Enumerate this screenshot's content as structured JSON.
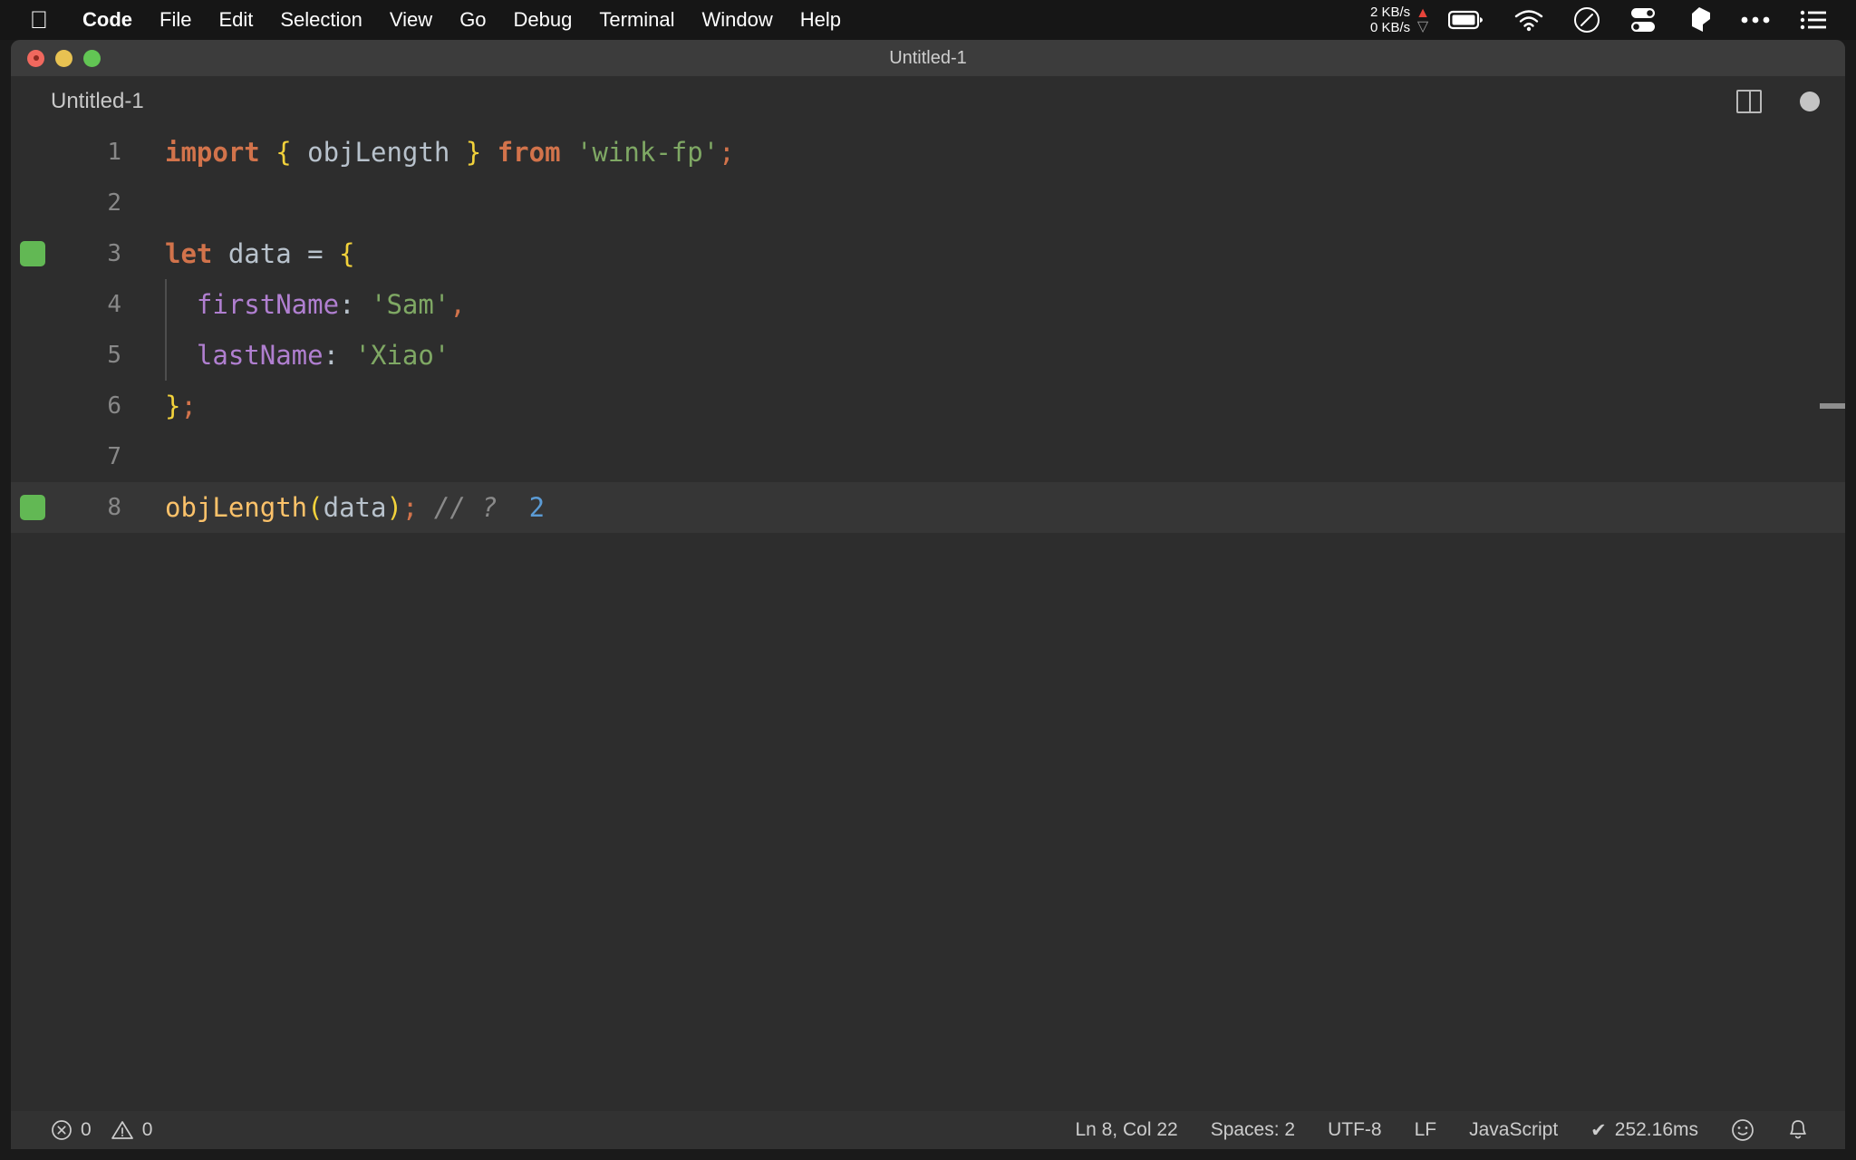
{
  "menubar": {
    "apple_icon": "apple-icon",
    "items": [
      {
        "label": "Code",
        "bold": true
      },
      {
        "label": "File",
        "bold": false
      },
      {
        "label": "Edit",
        "bold": false
      },
      {
        "label": "Selection",
        "bold": false
      },
      {
        "label": "View",
        "bold": false
      },
      {
        "label": "Go",
        "bold": false
      },
      {
        "label": "Debug",
        "bold": false
      },
      {
        "label": "Terminal",
        "bold": false
      },
      {
        "label": "Window",
        "bold": false
      },
      {
        "label": "Help",
        "bold": false
      }
    ],
    "network": {
      "up": "2 KB/s",
      "down": "0 KB/s",
      "up_arrow": "▲",
      "down_arrow": "▽",
      "up_color": "#e8443a",
      "down_color": "#9a9a9a"
    },
    "right_icons": [
      "battery-icon",
      "wifi-icon",
      "speedometer-icon",
      "toggles-icon",
      "bartender-icon",
      "ellipsis-icon",
      "list-icon"
    ]
  },
  "window": {
    "title": "Untitled-1",
    "traffic_lights": [
      "close-button",
      "minimize-button",
      "maximize-button"
    ]
  },
  "tabbar": {
    "tab_label": "Untitled-1",
    "split_editor_label": "split-editor-icon",
    "dirty_indicator_label": "unsaved-changes-dot"
  },
  "editor": {
    "lines": [
      {
        "number": "1",
        "gutter_mark": false,
        "current": false,
        "indent_guide": false,
        "tokens": [
          {
            "t": "import",
            "c": "t-kw"
          },
          {
            "t": " ",
            "c": "t-plain"
          },
          {
            "t": "{",
            "c": "t-brace"
          },
          {
            "t": " objLength ",
            "c": "t-plain"
          },
          {
            "t": "}",
            "c": "t-brace"
          },
          {
            "t": " ",
            "c": "t-plain"
          },
          {
            "t": "from",
            "c": "t-kw"
          },
          {
            "t": " ",
            "c": "t-plain"
          },
          {
            "t": "'wink-fp'",
            "c": "t-str"
          },
          {
            "t": ";",
            "c": "t-punc"
          }
        ]
      },
      {
        "number": "2",
        "gutter_mark": false,
        "current": false,
        "indent_guide": false,
        "tokens": []
      },
      {
        "number": "3",
        "gutter_mark": true,
        "current": false,
        "indent_guide": false,
        "tokens": [
          {
            "t": "let",
            "c": "t-kw"
          },
          {
            "t": " data ",
            "c": "t-plain"
          },
          {
            "t": "=",
            "c": "t-op"
          },
          {
            "t": " ",
            "c": "t-plain"
          },
          {
            "t": "{",
            "c": "t-brace"
          }
        ]
      },
      {
        "number": "4",
        "gutter_mark": false,
        "current": false,
        "indent_guide": true,
        "tokens": [
          {
            "t": "  ",
            "c": "t-plain"
          },
          {
            "t": "firstName",
            "c": "t-prop"
          },
          {
            "t": ":",
            "c": "t-plain"
          },
          {
            "t": " ",
            "c": "t-plain"
          },
          {
            "t": "'Sam'",
            "c": "t-str"
          },
          {
            "t": ",",
            "c": "t-punc"
          }
        ]
      },
      {
        "number": "5",
        "gutter_mark": false,
        "current": false,
        "indent_guide": true,
        "tokens": [
          {
            "t": "  ",
            "c": "t-plain"
          },
          {
            "t": "lastName",
            "c": "t-prop"
          },
          {
            "t": ":",
            "c": "t-plain"
          },
          {
            "t": " ",
            "c": "t-plain"
          },
          {
            "t": "'Xiao'",
            "c": "t-str"
          }
        ]
      },
      {
        "number": "6",
        "gutter_mark": false,
        "current": false,
        "indent_guide": false,
        "tokens": [
          {
            "t": "}",
            "c": "t-brace"
          },
          {
            "t": ";",
            "c": "t-punc"
          }
        ]
      },
      {
        "number": "7",
        "gutter_mark": false,
        "current": false,
        "indent_guide": false,
        "tokens": []
      },
      {
        "number": "8",
        "gutter_mark": true,
        "current": true,
        "indent_guide": false,
        "tokens": [
          {
            "t": "objLength",
            "c": "t-func"
          },
          {
            "t": "(",
            "c": "t-paren"
          },
          {
            "t": "data",
            "c": "t-plain"
          },
          {
            "t": ")",
            "c": "t-paren"
          },
          {
            "t": ";",
            "c": "t-punc"
          },
          {
            "t": " ",
            "c": "t-plain"
          },
          {
            "t": "// ?",
            "c": "t-comment"
          },
          {
            "t": "  ",
            "c": "t-plain"
          },
          {
            "t": "2",
            "c": "t-num"
          }
        ]
      }
    ]
  },
  "statusbar": {
    "errors": "0",
    "warnings": "0",
    "position": "Ln 8, Col 22",
    "indentation": "Spaces: 2",
    "encoding": "UTF-8",
    "eol": "LF",
    "language": "JavaScript",
    "quokka_check": "✔",
    "quokka_time": "252.16ms",
    "feedback_icon": "smiley-icon",
    "notifications_icon": "bell-icon"
  },
  "colors": {
    "editor_bg": "#2d2d2d",
    "titlebar_bg": "#3c3c3c",
    "statusbar_bg": "#323232",
    "menubar_bg": "#161616",
    "gutter_mark": "#62b854",
    "keyword": "#d2734b",
    "string": "#7fa864",
    "property": "#b07fd0",
    "function": "#fcc26a",
    "brace": "#f2d23b",
    "number": "#5b9bd5",
    "comment": "#8a8a8a"
  }
}
